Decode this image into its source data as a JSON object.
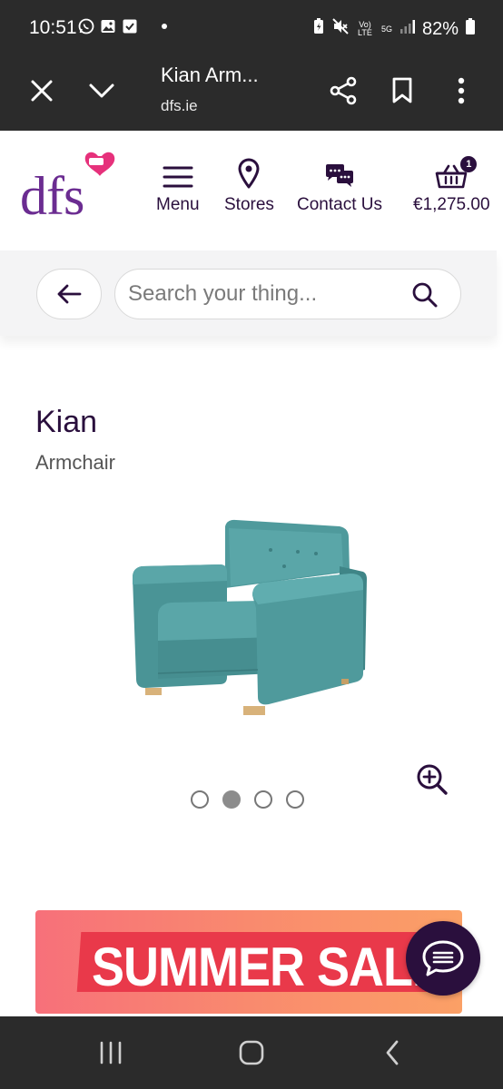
{
  "status_bar": {
    "time": "10:51",
    "icons_left": [
      "whatsapp-icon",
      "gallery-icon",
      "checkbox-icon",
      "dot-icon"
    ],
    "icons_right": [
      "battery-saver-icon",
      "mute-icon",
      "volte-icon",
      "5g-icon",
      "signal-icon",
      "battery-icon"
    ],
    "volte_label": "Vo) LTE",
    "network_label": "5G",
    "battery": "82%"
  },
  "browser": {
    "page_title": "Kian Arm...",
    "url": "dfs.ie",
    "icons": [
      "close-icon",
      "chevron-down-icon",
      "share-icon",
      "bookmark-icon",
      "more-icon"
    ]
  },
  "header": {
    "logo_text": "dfs",
    "nav": [
      {
        "label": "Menu",
        "icon": "hamburger-icon"
      },
      {
        "label": "Stores",
        "icon": "location-pin-icon"
      },
      {
        "label": "Contact Us",
        "icon": "chat-bubbles-icon"
      },
      {
        "label": "€1,275.00",
        "icon": "basket-icon"
      }
    ],
    "basket_count": "1"
  },
  "search": {
    "placeholder": "Search your thing...",
    "value": ""
  },
  "product": {
    "name": "Kian",
    "type": "Armchair",
    "gallery_total": 4,
    "gallery_active": 2
  },
  "promo": {
    "text": "SUMMER SALE"
  },
  "colors": {
    "brand_purple": "#2a0f3d",
    "logo_purple": "#6b2c91",
    "heart_pink": "#e6317b",
    "chair_teal": "#4f9a9c",
    "promo_red": "#e9394a",
    "chrome_dark": "#2b2b2b"
  }
}
